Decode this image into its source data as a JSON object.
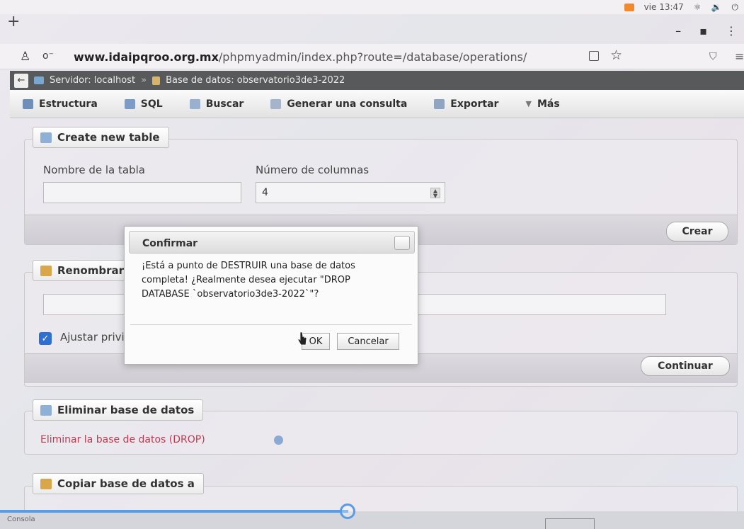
{
  "system": {
    "clock": "vie 13:47"
  },
  "browser": {
    "url_host": "www.idaipqroo.org.mx",
    "url_path": "/phpmyadmin/index.php?route=/database/operations/"
  },
  "breadcrumb": {
    "server": "Servidor: localhost",
    "separator": "»",
    "database": "Base de datos: observatorio3de3-2022"
  },
  "tabs": [
    {
      "label": "Estructura",
      "color": "#6f8fb8"
    },
    {
      "label": "SQL",
      "color": "#7d9bc6"
    },
    {
      "label": "Buscar",
      "color": "#9ab0cf"
    },
    {
      "label": "Generar una consulta",
      "color": "#a4b5c9"
    },
    {
      "label": "Exportar",
      "color": "#8ea6c4"
    },
    {
      "label": "Más",
      "color": "#777777"
    }
  ],
  "create_table": {
    "legend": "Create new table",
    "name_label": "Nombre de la tabla",
    "columns_label": "Número de columnas",
    "columns_value": "4",
    "create_button": "Crear"
  },
  "rename": {
    "legend": "Renombrar base de datos a",
    "checkbox_label": "Ajustar privilegios",
    "continue_button": "Continuar"
  },
  "drop": {
    "legend": "Eliminar base de datos",
    "link": "Eliminar la base de datos (DROP)"
  },
  "copy": {
    "legend": "Copiar base de datos a"
  },
  "dialog": {
    "title": "Confirmar",
    "message": "¡Está a punto de DESTRUIR una base de datos completa! ¿Realmente desea ejecutar \"DROP DATABASE `observatorio3de3-2022`\"?",
    "ok": "OK",
    "cancel": "Cancelar"
  },
  "status": {
    "label": "Consola"
  }
}
